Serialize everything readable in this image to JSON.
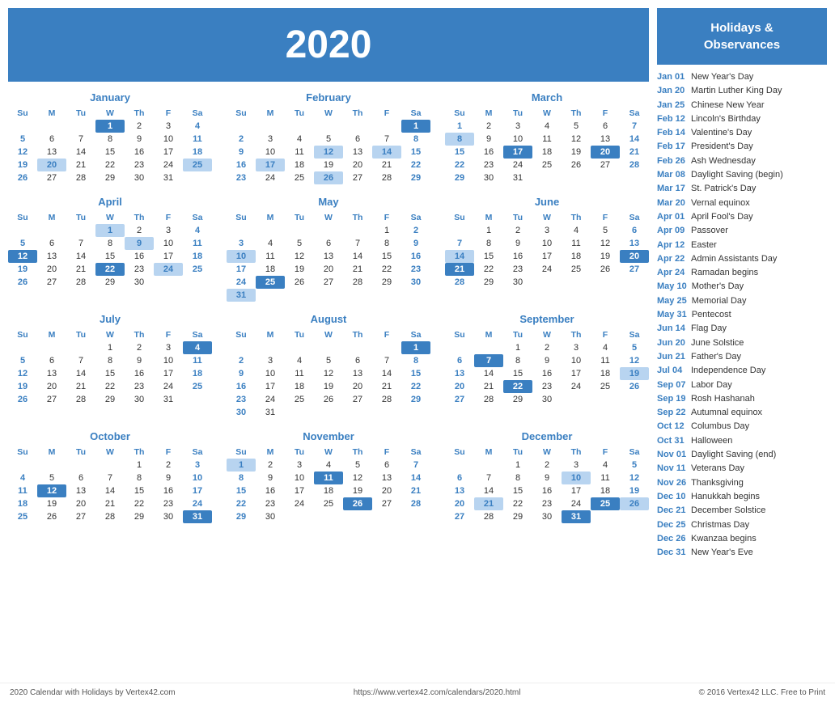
{
  "header": {
    "year": "2020"
  },
  "holidays_header": "Holidays &\nObservances",
  "holidays": [
    {
      "date": "Jan 01",
      "name": "New Year's Day"
    },
    {
      "date": "Jan 20",
      "name": "Martin Luther King Day"
    },
    {
      "date": "Jan 25",
      "name": "Chinese New Year"
    },
    {
      "date": "Feb 12",
      "name": "Lincoln's Birthday"
    },
    {
      "date": "Feb 14",
      "name": "Valentine's Day"
    },
    {
      "date": "Feb 17",
      "name": "President's Day"
    },
    {
      "date": "Feb 26",
      "name": "Ash Wednesday"
    },
    {
      "date": "Mar 08",
      "name": "Daylight Saving (begin)"
    },
    {
      "date": "Mar 17",
      "name": "St. Patrick's Day"
    },
    {
      "date": "Mar 20",
      "name": "Vernal equinox"
    },
    {
      "date": "Apr 01",
      "name": "April Fool's Day"
    },
    {
      "date": "Apr 09",
      "name": "Passover"
    },
    {
      "date": "Apr 12",
      "name": "Easter"
    },
    {
      "date": "Apr 22",
      "name": "Admin Assistants Day"
    },
    {
      "date": "Apr 24",
      "name": "Ramadan begins"
    },
    {
      "date": "May 10",
      "name": "Mother's Day"
    },
    {
      "date": "May 25",
      "name": "Memorial Day"
    },
    {
      "date": "May 31",
      "name": "Pentecost"
    },
    {
      "date": "Jun 14",
      "name": "Flag Day"
    },
    {
      "date": "Jun 20",
      "name": "June Solstice"
    },
    {
      "date": "Jun 21",
      "name": "Father's Day"
    },
    {
      "date": "Jul 04",
      "name": "Independence Day"
    },
    {
      "date": "Sep 07",
      "name": "Labor Day"
    },
    {
      "date": "Sep 19",
      "name": "Rosh Hashanah"
    },
    {
      "date": "Sep 22",
      "name": "Autumnal equinox"
    },
    {
      "date": "Oct 12",
      "name": "Columbus Day"
    },
    {
      "date": "Oct 31",
      "name": "Halloween"
    },
    {
      "date": "Nov 01",
      "name": "Daylight Saving (end)"
    },
    {
      "date": "Nov 11",
      "name": "Veterans Day"
    },
    {
      "date": "Nov 26",
      "name": "Thanksgiving"
    },
    {
      "date": "Dec 10",
      "name": "Hanukkah begins"
    },
    {
      "date": "Dec 21",
      "name": "December Solstice"
    },
    {
      "date": "Dec 25",
      "name": "Christmas Day"
    },
    {
      "date": "Dec 26",
      "name": "Kwanzaa begins"
    },
    {
      "date": "Dec 31",
      "name": "New Year's Eve"
    }
  ],
  "months": [
    {
      "name": "January",
      "weeks": [
        [
          null,
          null,
          null,
          "1",
          "2",
          "3",
          "4"
        ],
        [
          "5",
          "6",
          "7",
          "8",
          "9",
          "10",
          "11"
        ],
        [
          "12",
          "13",
          "14",
          "15",
          "16",
          "17",
          "18"
        ],
        [
          "19",
          "20",
          "21",
          "22",
          "23",
          "24",
          "25"
        ],
        [
          "26",
          "27",
          "28",
          "29",
          "30",
          "31",
          null
        ]
      ],
      "highlights_blue": [
        "1"
      ],
      "highlights_light": [
        "20",
        "25"
      ]
    },
    {
      "name": "February",
      "weeks": [
        [
          null,
          null,
          null,
          null,
          null,
          null,
          "1"
        ],
        [
          "2",
          "3",
          "4",
          "5",
          "6",
          "7",
          "8"
        ],
        [
          "9",
          "10",
          "11",
          "12",
          "13",
          "14",
          "15"
        ],
        [
          "16",
          "17",
          "18",
          "19",
          "20",
          "21",
          "22"
        ],
        [
          "23",
          "24",
          "25",
          "26",
          "27",
          "28",
          "29"
        ]
      ],
      "highlights_blue": [
        "1"
      ],
      "highlights_light": [
        "12",
        "14",
        "17",
        "26"
      ]
    },
    {
      "name": "March",
      "weeks": [
        [
          "1",
          "2",
          "3",
          "4",
          "5",
          "6",
          "7"
        ],
        [
          "8",
          "9",
          "10",
          "11",
          "12",
          "13",
          "14"
        ],
        [
          "15",
          "16",
          "17",
          "18",
          "19",
          "20",
          "21"
        ],
        [
          "22",
          "23",
          "24",
          "25",
          "26",
          "27",
          "28"
        ],
        [
          "29",
          "30",
          "31",
          null,
          null,
          null,
          null
        ]
      ],
      "highlights_blue": [
        "17",
        "20"
      ],
      "highlights_light": [
        "8"
      ]
    },
    {
      "name": "April",
      "weeks": [
        [
          null,
          null,
          null,
          "1",
          "2",
          "3",
          "4"
        ],
        [
          "5",
          "6",
          "7",
          "8",
          "9",
          "10",
          "11"
        ],
        [
          "12",
          "13",
          "14",
          "15",
          "16",
          "17",
          "18"
        ],
        [
          "19",
          "20",
          "21",
          "22",
          "23",
          "24",
          "25"
        ],
        [
          "26",
          "27",
          "28",
          "29",
          "30",
          null,
          null
        ]
      ],
      "highlights_blue": [
        "12",
        "22"
      ],
      "highlights_light": [
        "1",
        "9",
        "24"
      ]
    },
    {
      "name": "May",
      "weeks": [
        [
          null,
          null,
          null,
          null,
          null,
          "1",
          "2"
        ],
        [
          "3",
          "4",
          "5",
          "6",
          "7",
          "8",
          "9"
        ],
        [
          "10",
          "11",
          "12",
          "13",
          "14",
          "15",
          "16"
        ],
        [
          "17",
          "18",
          "19",
          "20",
          "21",
          "22",
          "23"
        ],
        [
          "24",
          "25",
          "26",
          "27",
          "28",
          "29",
          "30"
        ],
        [
          "31",
          null,
          null,
          null,
          null,
          null,
          null
        ]
      ],
      "highlights_blue": [
        "25"
      ],
      "highlights_light": [
        "10",
        "31"
      ]
    },
    {
      "name": "June",
      "weeks": [
        [
          null,
          "1",
          "2",
          "3",
          "4",
          "5",
          "6"
        ],
        [
          "7",
          "8",
          "9",
          "10",
          "11",
          "12",
          "13"
        ],
        [
          "14",
          "15",
          "16",
          "17",
          "18",
          "19",
          "20"
        ],
        [
          "21",
          "22",
          "23",
          "24",
          "25",
          "26",
          "27"
        ],
        [
          "28",
          "29",
          "30",
          null,
          null,
          null,
          null
        ]
      ],
      "highlights_blue": [
        "20",
        "21"
      ],
      "highlights_light": [
        "14"
      ]
    },
    {
      "name": "July",
      "weeks": [
        [
          null,
          null,
          null,
          "1",
          "2",
          "3",
          "4"
        ],
        [
          "5",
          "6",
          "7",
          "8",
          "9",
          "10",
          "11"
        ],
        [
          "12",
          "13",
          "14",
          "15",
          "16",
          "17",
          "18"
        ],
        [
          "19",
          "20",
          "21",
          "22",
          "23",
          "24",
          "25"
        ],
        [
          "26",
          "27",
          "28",
          "29",
          "30",
          "31",
          null
        ]
      ],
      "highlights_blue": [
        "4"
      ],
      "highlights_light": []
    },
    {
      "name": "August",
      "weeks": [
        [
          null,
          null,
          null,
          null,
          null,
          null,
          "1"
        ],
        [
          "2",
          "3",
          "4",
          "5",
          "6",
          "7",
          "8"
        ],
        [
          "9",
          "10",
          "11",
          "12",
          "13",
          "14",
          "15"
        ],
        [
          "16",
          "17",
          "18",
          "19",
          "20",
          "21",
          "22"
        ],
        [
          "23",
          "24",
          "25",
          "26",
          "27",
          "28",
          "29"
        ],
        [
          "30",
          "31",
          null,
          null,
          null,
          null,
          null
        ]
      ],
      "highlights_blue": [
        "1"
      ],
      "highlights_light": []
    },
    {
      "name": "September",
      "weeks": [
        [
          null,
          null,
          "1",
          "2",
          "3",
          "4",
          "5"
        ],
        [
          "6",
          "7",
          "8",
          "9",
          "10",
          "11",
          "12"
        ],
        [
          "13",
          "14",
          "15",
          "16",
          "17",
          "18",
          "19"
        ],
        [
          "20",
          "21",
          "22",
          "23",
          "24",
          "25",
          "26"
        ],
        [
          "27",
          "28",
          "29",
          "30",
          null,
          null,
          null
        ]
      ],
      "highlights_blue": [
        "7",
        "22"
      ],
      "highlights_light": [
        "19"
      ]
    },
    {
      "name": "October",
      "weeks": [
        [
          null,
          null,
          null,
          null,
          "1",
          "2",
          "3"
        ],
        [
          "4",
          "5",
          "6",
          "7",
          "8",
          "9",
          "10"
        ],
        [
          "11",
          "12",
          "13",
          "14",
          "15",
          "16",
          "17"
        ],
        [
          "18",
          "19",
          "20",
          "21",
          "22",
          "23",
          "24"
        ],
        [
          "25",
          "26",
          "27",
          "28",
          "29",
          "30",
          "31"
        ]
      ],
      "highlights_blue": [
        "12",
        "31"
      ],
      "highlights_light": []
    },
    {
      "name": "November",
      "weeks": [
        [
          "1",
          "2",
          "3",
          "4",
          "5",
          "6",
          "7"
        ],
        [
          "8",
          "9",
          "10",
          "11",
          "12",
          "13",
          "14"
        ],
        [
          "15",
          "16",
          "17",
          "18",
          "19",
          "20",
          "21"
        ],
        [
          "22",
          "23",
          "24",
          "25",
          "26",
          "27",
          "28"
        ],
        [
          "29",
          "30",
          null,
          null,
          null,
          null,
          null
        ]
      ],
      "highlights_blue": [
        "11",
        "26"
      ],
      "highlights_light": [
        "1"
      ]
    },
    {
      "name": "December",
      "weeks": [
        [
          null,
          null,
          "1",
          "2",
          "3",
          "4",
          "5"
        ],
        [
          "6",
          "7",
          "8",
          "9",
          "10",
          "11",
          "12"
        ],
        [
          "13",
          "14",
          "15",
          "16",
          "17",
          "18",
          "19"
        ],
        [
          "20",
          "21",
          "22",
          "23",
          "24",
          "25",
          "26"
        ],
        [
          "27",
          "28",
          "29",
          "30",
          "31",
          null,
          null
        ]
      ],
      "highlights_blue": [
        "25",
        "31"
      ],
      "highlights_light": [
        "10",
        "21",
        "26"
      ]
    }
  ],
  "footer": {
    "left": "2020 Calendar with Holidays by Vertex42.com",
    "center": "https://www.vertex42.com/calendars/2020.html",
    "right": "© 2016 Vertex42 LLC. Free to Print"
  }
}
